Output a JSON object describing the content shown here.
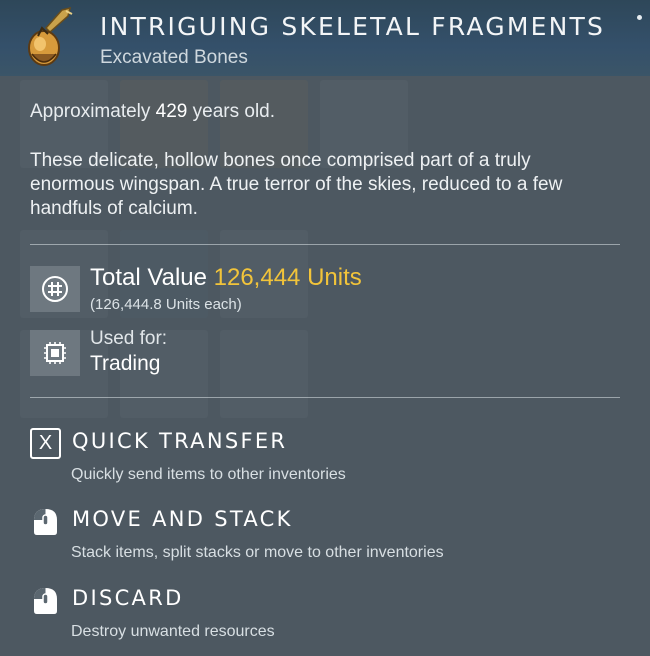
{
  "item": {
    "title": "INTRIGUING SKELETAL FRAGMENTS",
    "subtitle": "Excavated Bones",
    "icon": "skeletal-fragment-icon"
  },
  "age": {
    "prefix": "Approximately",
    "years": "429",
    "suffix": "years old."
  },
  "description": "These delicate, hollow bones once comprised part of a truly enormous wingspan. A true terror of the skies, reduced to a few handfuls of calcium.",
  "value": {
    "label": "Total Value",
    "amount": "126,444 Units",
    "each": "(126,444.8 Units each)",
    "icon": "currency-icon"
  },
  "usage": {
    "label": "Used for:",
    "value": "Trading",
    "icon": "trade-chip-icon"
  },
  "actions": [
    {
      "label": "QUICK TRANSFER",
      "description": "Quickly send items to other inventories",
      "key_icon": "x-key-icon",
      "key_text": "X"
    },
    {
      "label": "MOVE AND STACK",
      "description": "Stack items, split stacks or move to other inventories",
      "key_icon": "mouse-left-click-icon"
    },
    {
      "label": "DISCARD",
      "description": "Destroy unwanted resources",
      "key_icon": "mouse-left-click-icon"
    }
  ],
  "colors": {
    "accent_value": "#f2c43a",
    "header_bg": "#34506a",
    "panel_bg": "#56616a"
  }
}
